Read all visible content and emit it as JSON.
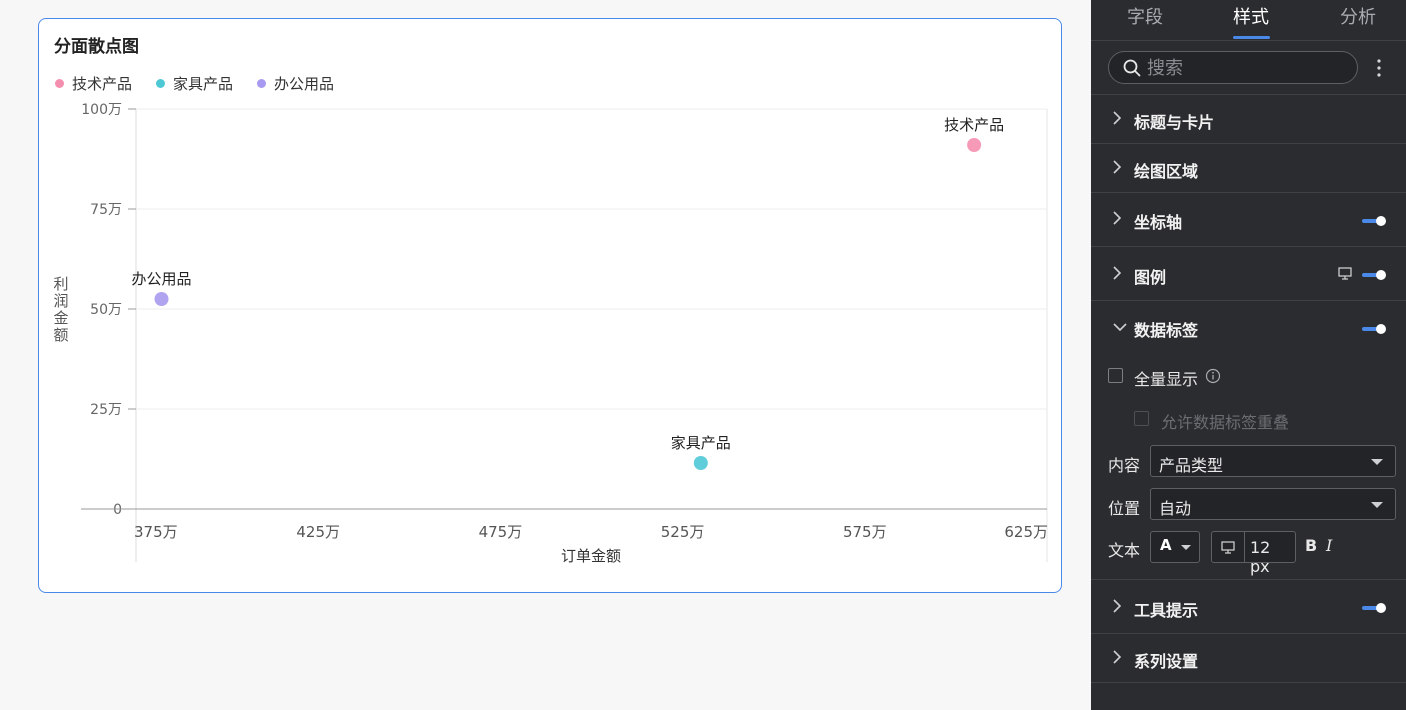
{
  "chart_card": {
    "title": "分面散点图"
  },
  "chart_data": {
    "type": "scatter",
    "series": [
      {
        "name": "技术产品",
        "color": "#f58fb0",
        "x": 6050000,
        "y": 910000,
        "label": "技术产品"
      },
      {
        "name": "家具产品",
        "color": "#4fc8d6",
        "x": 5300000,
        "y": 115000,
        "label": "家具产品"
      },
      {
        "name": "办公用品",
        "color": "#a79af0",
        "x": 3820000,
        "y": 525000,
        "label": "办公用品"
      }
    ],
    "xlabel": "订单金额",
    "ylabel": "利润金额",
    "xlim": [
      3750000,
      6250000
    ],
    "ylim": [
      0,
      1000000
    ],
    "x_ticks": [
      "375万",
      "425万",
      "475万",
      "525万",
      "575万",
      "625万"
    ],
    "x_tick_values": [
      3750000,
      4250000,
      4750000,
      5250000,
      5750000,
      6250000
    ],
    "y_ticks": [
      "0",
      "25万",
      "50万",
      "75万",
      "100万"
    ],
    "y_tick_values": [
      0,
      250000,
      500000,
      750000,
      1000000
    ],
    "grid": true,
    "legend_position": "top-left"
  },
  "panel": {
    "tabs": [
      {
        "label": "字段",
        "active": false
      },
      {
        "label": "样式",
        "active": true
      },
      {
        "label": "分析",
        "active": false
      }
    ],
    "search_placeholder": "搜索",
    "sections": {
      "title_card": "标题与卡片",
      "plot_area": "绘图区域",
      "axis": "坐标轴",
      "legend": "图例",
      "data_labels": "数据标签",
      "tooltip": "工具提示",
      "series": "系列设置"
    },
    "data_labels": {
      "show_all": "全量显示",
      "allow_overlap": "允许数据标签重叠",
      "content_label": "内容",
      "content_value": "产品类型",
      "position_label": "位置",
      "position_value": "自动",
      "text_label": "文本",
      "font_color_letter": "A",
      "font_size": "12 px",
      "bold": "B",
      "italic": "I"
    },
    "toggles": {
      "axis": true,
      "legend": true,
      "data_labels": true,
      "tooltip": true
    },
    "accent_color": "#4b89e8"
  }
}
